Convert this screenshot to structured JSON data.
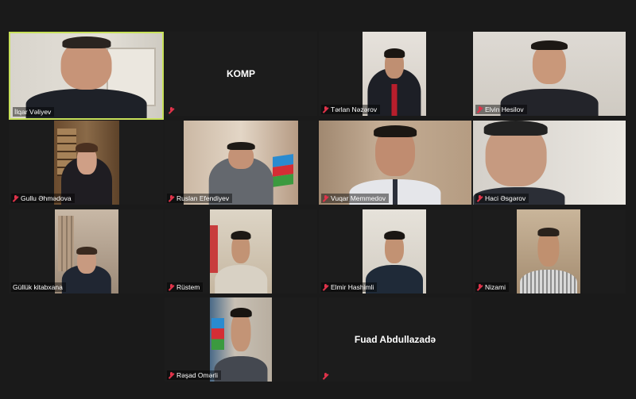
{
  "participants": [
    {
      "name": "İlqar Vəliyev",
      "active": true
    },
    {
      "name": "KOMP",
      "center": true
    },
    {
      "name": "Tərlan Nəzərov"
    },
    {
      "name": "Elvin Hesilov"
    },
    {
      "name": "Gullu Əhmədova"
    },
    {
      "name": "Ruslan Efendiyev"
    },
    {
      "name": "Vuqar Memmedov"
    },
    {
      "name": "Haci Əsgərov"
    },
    {
      "name": "Güllük kitabxana"
    },
    {
      "name": "Rüstem"
    },
    {
      "name": "Elmir Hashimli"
    },
    {
      "name": "Nizami"
    },
    {
      "name": "Rəşad Omərli"
    },
    {
      "name": "Fuad Abdullazadə",
      "center": true
    }
  ],
  "colors": {
    "active_border": "#c8e15a",
    "mic_muted": "#e0334a",
    "background": "#1a1a1a",
    "tile": "#1c1c1c"
  },
  "icons": {
    "muted_mic": "mic-off-icon"
  }
}
